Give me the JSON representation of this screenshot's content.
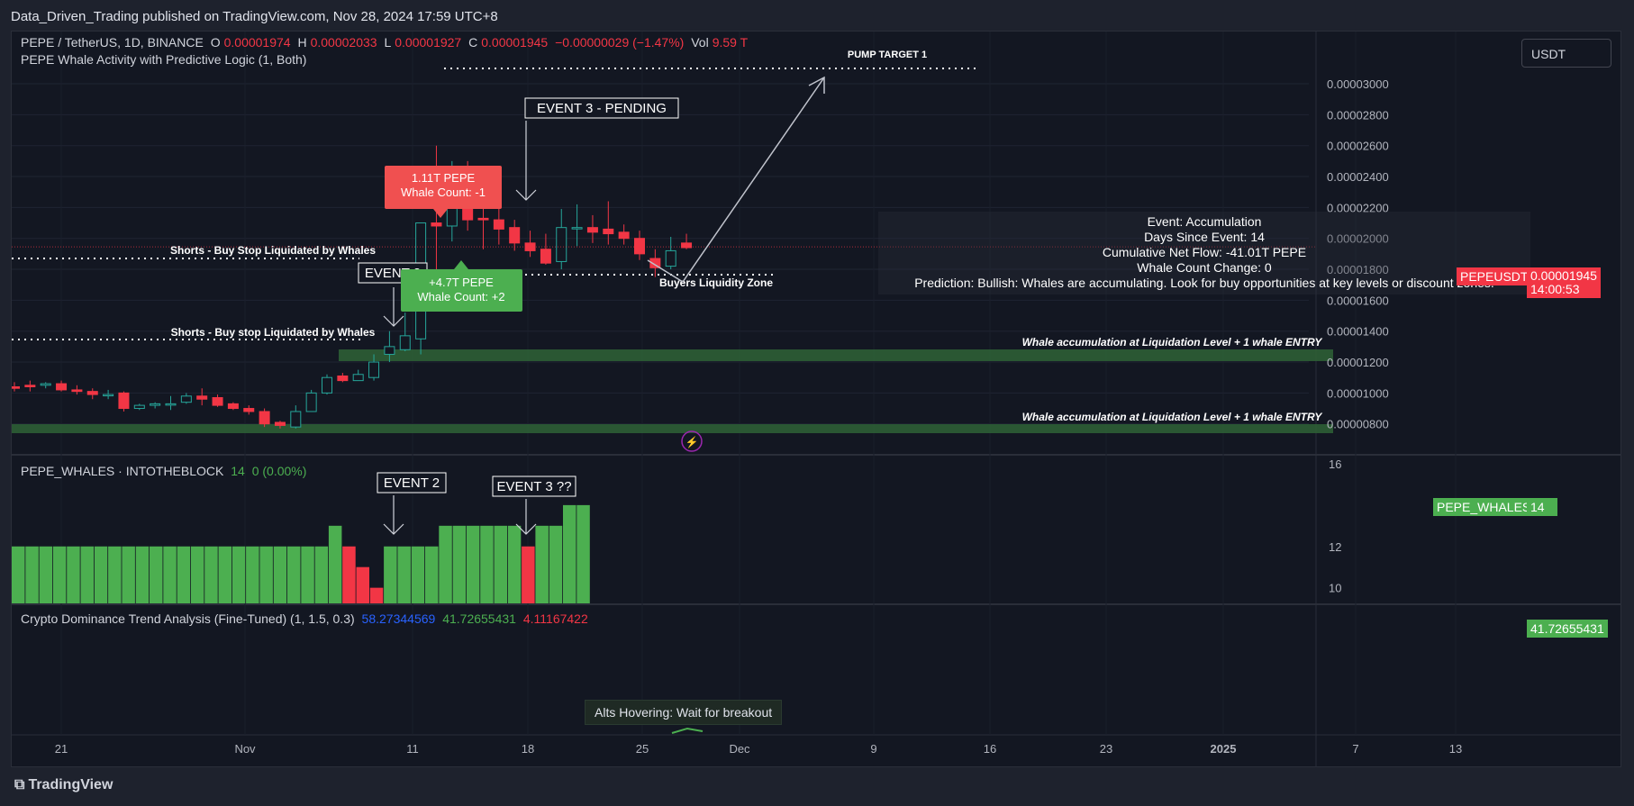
{
  "header": {
    "published": "Data_Driven_Trading published on TradingView.com, Nov 28, 2024 17:59 UTC+8"
  },
  "main_legend": {
    "symbol": "PEPE / TetherUS, 1D, BINANCE",
    "o_label": "O",
    "o_value": "0.00001974",
    "h_label": "H",
    "h_value": "0.00002033",
    "l_label": "L",
    "l_value": "0.00001927",
    "c_label": "C",
    "c_value": "0.00001945",
    "change": "−0.00000029 (−1.47%)",
    "vol_label": "Vol",
    "vol_value": "9.59 T",
    "indicator": "PEPE Whale Activity with Predictive Logic (1, Both)"
  },
  "currency_button": "USDT",
  "whales_legend": {
    "name": "PEPE_WHALES · INTOTHEBLOCK",
    "value": "14",
    "change": "0 (0.00%)"
  },
  "dominance_legend": {
    "name": "Crypto Dominance Trend Analysis (Fine-Tuned) (1, 1.5, 0.3)",
    "v1": "58.27344569",
    "v2": "41.72655431",
    "v3": "4.11167422"
  },
  "price_tags": {
    "symbol": "PEPEUSDT",
    "price": "0.00001945",
    "countdown": "14:00:53",
    "whales_label": "PEPE_WHALES",
    "whales_value": "14",
    "dominance_value": "41.72655431"
  },
  "info_box": {
    "line1": "Event: Accumulation",
    "line2": "Days Since Event: 14",
    "line3": "Cumulative Net Flow: -41.01T PEPE",
    "line4": "Whale Count Change: 0",
    "line5": "Prediction: Bullish: Whales are accumulating. Look for buy opportunities at key levels or discount zones."
  },
  "annotations": {
    "pump_target": "PUMP  TARGET 1",
    "event3_pending": "EVENT 3 - PENDING",
    "event2_main": "EVENT 2",
    "shorts1": "Shorts - Buy Stop Liquidated by Whales",
    "shorts2": "Shorts - Buy stop Liquidated by Whales",
    "buyers_zone": "Buyers Liquidity Zone",
    "whale_zone1": "Whale accumulation at Liquidation Level + 1 whale ENTRY",
    "whale_zone2": "Whale accumulation at Liquidation Level + 1 whale ENTRY",
    "red_label_l1": "1.11T PEPE",
    "red_label_l2": "Whale Count: -1",
    "green_label_l1": "+4.7T PEPE",
    "green_label_l2": "Whale Count: +2",
    "event2_lower": "EVENT 2",
    "event3_lower": "EVENT 3 ??",
    "alts": "Alts Hovering: Wait for breakout"
  },
  "footer": {
    "brand": "TradingView"
  },
  "colors": {
    "up": "#26a69a",
    "down": "#f23645",
    "bar_green": "#4caf50",
    "zone": "#2e5e35"
  },
  "chart_data": [
    {
      "type": "candlestick",
      "title": "PEPE / TetherUS, 1D, BINANCE",
      "y_axis_ticks": [
        8e-06,
        1e-05,
        1.2e-05,
        1.4e-05,
        1.6e-05,
        1.8e-05,
        2e-05,
        2.2e-05,
        2.4e-05,
        2.6e-05,
        2.8e-05,
        3e-05
      ],
      "y_tick_labels": [
        "0.00000800",
        "0.00001000",
        "0.00001200",
        "0.00001400",
        "0.00001600",
        "0.00001800",
        "0.00002000",
        "0.00002200",
        "0.00002400",
        "0.00002600",
        "0.00002800",
        "0.00003000"
      ],
      "ylim": [
        7.4e-06,
        3.14e-05
      ],
      "x_tick_labels": [
        "21",
        "Nov",
        "11",
        "18",
        "25",
        "Dec",
        "9",
        "16",
        "23",
        "2025",
        "7",
        "13"
      ],
      "candles": [
        {
          "o": 1.04e-05,
          "h": 1.07e-05,
          "l": 1.01e-05,
          "c": 1.03e-05
        },
        {
          "o": 1.05e-05,
          "h": 1.08e-05,
          "l": 1.01e-05,
          "c": 1.04e-05
        },
        {
          "o": 1.05e-05,
          "h": 1.07e-05,
          "l": 1.03e-05,
          "c": 1.06e-05
        },
        {
          "o": 1.06e-05,
          "h": 1.08e-05,
          "l": 1.01e-05,
          "c": 1.02e-05
        },
        {
          "o": 1.02e-05,
          "h": 1.05e-05,
          "l": 9.9e-06,
          "c": 1.01e-05
        },
        {
          "o": 1.01e-05,
          "h": 1.03e-05,
          "l": 9.6e-06,
          "c": 9.9e-06
        },
        {
          "o": 9.9e-06,
          "h": 1.02e-05,
          "l": 9.6e-06,
          "c": 9.9e-06
        },
        {
          "o": 1e-05,
          "h": 1.01e-05,
          "l": 8.8e-06,
          "c": 9e-06
        },
        {
          "o": 9e-06,
          "h": 9.3e-06,
          "l": 8.9e-06,
          "c": 9.2e-06
        },
        {
          "o": 9.2e-06,
          "h": 9.4e-06,
          "l": 9e-06,
          "c": 9.3e-06
        },
        {
          "o": 9.3e-06,
          "h": 9.8e-06,
          "l": 8.9e-06,
          "c": 9.3e-06
        },
        {
          "o": 9.4e-06,
          "h": 1e-05,
          "l": 9.3e-06,
          "c": 9.8e-06
        },
        {
          "o": 9.8e-06,
          "h": 1.03e-05,
          "l": 9.2e-06,
          "c": 9.6e-06
        },
        {
          "o": 9.7e-06,
          "h": 9.9e-06,
          "l": 9.1e-06,
          "c": 9.2e-06
        },
        {
          "o": 9.3e-06,
          "h": 9.4e-06,
          "l": 8.9e-06,
          "c": 9e-06
        },
        {
          "o": 9e-06,
          "h": 9.2e-06,
          "l": 8.6e-06,
          "c": 8.8e-06
        },
        {
          "o": 8.8e-06,
          "h": 9e-06,
          "l": 7.8e-06,
          "c": 8e-06
        },
        {
          "o": 8.1e-06,
          "h": 8.2e-06,
          "l": 7.7e-06,
          "c": 7.9e-06
        },
        {
          "o": 7.8e-06,
          "h": 9.2e-06,
          "l": 7.7e-06,
          "c": 8.8e-06
        },
        {
          "o": 8.8e-06,
          "h": 1.02e-05,
          "l": 8.8e-06,
          "c": 1e-05
        },
        {
          "o": 1e-05,
          "h": 1.12e-05,
          "l": 9.9e-06,
          "c": 1.1e-05
        },
        {
          "o": 1.11e-05,
          "h": 1.13e-05,
          "l": 1.07e-05,
          "c": 1.08e-05
        },
        {
          "o": 1.08e-05,
          "h": 1.15e-05,
          "l": 1.08e-05,
          "c": 1.12e-05
        },
        {
          "o": 1.1e-05,
          "h": 1.25e-05,
          "l": 1.08e-05,
          "c": 1.2e-05
        },
        {
          "o": 1.25e-05,
          "h": 1.4e-05,
          "l": 1.2e-05,
          "c": 1.3e-05
        },
        {
          "o": 1.28e-05,
          "h": 1.52e-05,
          "l": 1.27e-05,
          "c": 1.37e-05
        },
        {
          "o": 1.35e-05,
          "h": 2.1e-05,
          "l": 1.25e-05,
          "c": 2.1e-05
        },
        {
          "o": 2.1e-05,
          "h": 2.6e-05,
          "l": 1.8e-05,
          "c": 2.08e-05
        },
        {
          "o": 2.08e-05,
          "h": 2.5e-05,
          "l": 1.98e-05,
          "c": 2.4e-05
        },
        {
          "o": 2.4e-05,
          "h": 2.5e-05,
          "l": 2.05e-05,
          "c": 2.12e-05
        },
        {
          "o": 2.13e-05,
          "h": 2.25e-05,
          "l": 1.93e-05,
          "c": 2.12e-05
        },
        {
          "o": 2.12e-05,
          "h": 2.26e-05,
          "l": 1.96e-05,
          "c": 2.06e-05
        },
        {
          "o": 2.07e-05,
          "h": 2.12e-05,
          "l": 1.92e-05,
          "c": 1.97e-05
        },
        {
          "o": 1.97e-05,
          "h": 2.05e-05,
          "l": 1.88e-05,
          "c": 1.92e-05
        },
        {
          "o": 1.93e-05,
          "h": 2.03e-05,
          "l": 1.83e-05,
          "c": 1.84e-05
        },
        {
          "o": 1.85e-05,
          "h": 2.19e-05,
          "l": 1.8e-05,
          "c": 2.07e-05
        },
        {
          "o": 2.07e-05,
          "h": 2.22e-05,
          "l": 1.95e-05,
          "c": 2.07e-05
        },
        {
          "o": 2.07e-05,
          "h": 2.15e-05,
          "l": 1.97e-05,
          "c": 2.04e-05
        },
        {
          "o": 2.06e-05,
          "h": 2.24e-05,
          "l": 1.96e-05,
          "c": 2.03e-05
        },
        {
          "o": 2.04e-05,
          "h": 2.09e-05,
          "l": 1.96e-05,
          "c": 2e-05
        },
        {
          "o": 2e-05,
          "h": 2.05e-05,
          "l": 1.86e-05,
          "c": 1.9e-05
        },
        {
          "o": 1.87e-05,
          "h": 1.93e-05,
          "l": 1.75e-05,
          "c": 1.81e-05
        },
        {
          "o": 1.82e-05,
          "h": 2.01e-05,
          "l": 1.8e-05,
          "c": 1.92e-05
        },
        {
          "o": 1.97e-05,
          "h": 2.03e-05,
          "l": 1.93e-05,
          "c": 1.94e-05
        }
      ]
    },
    {
      "type": "bar",
      "title": "PEPE_WHALES · INTOTHEBLOCK",
      "y_axis_ticks": [
        10,
        12,
        16
      ],
      "ylim": [
        9.2,
        16
      ],
      "values": [
        12,
        12,
        12,
        12,
        12,
        12,
        12,
        12,
        12,
        12,
        12,
        12,
        12,
        12,
        12,
        12,
        12,
        12,
        12,
        12,
        12,
        12,
        12,
        13,
        12,
        11,
        10,
        12,
        12,
        12,
        12,
        13,
        13,
        13,
        13,
        13,
        13,
        12,
        13,
        13,
        14,
        14
      ],
      "colors": [
        "g",
        "g",
        "g",
        "g",
        "g",
        "g",
        "g",
        "g",
        "g",
        "g",
        "g",
        "g",
        "g",
        "g",
        "g",
        "g",
        "g",
        "g",
        "g",
        "g",
        "g",
        "g",
        "g",
        "g",
        "r",
        "r",
        "r",
        "g",
        "g",
        "g",
        "g",
        "g",
        "g",
        "g",
        "g",
        "g",
        "g",
        "r",
        "g",
        "g",
        "g",
        "g"
      ]
    }
  ]
}
